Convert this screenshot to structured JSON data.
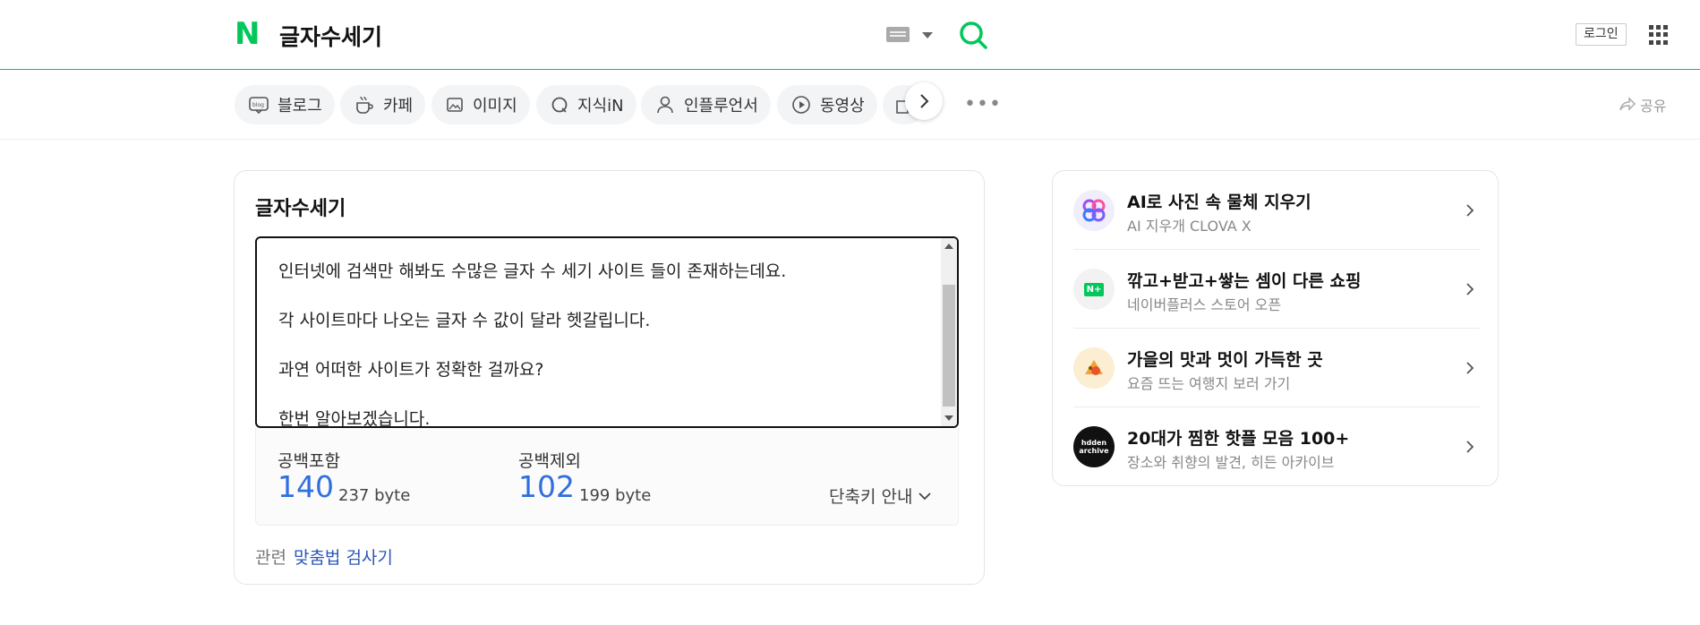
{
  "header": {
    "logo": "N",
    "query": "글자수세기",
    "login_label": "로그인"
  },
  "tabs": [
    {
      "label": "블로그",
      "icon": "blog-icon"
    },
    {
      "label": "카페",
      "icon": "cafe-icon"
    },
    {
      "label": "이미지",
      "icon": "image-icon"
    },
    {
      "label": "지식iN",
      "icon": "kin-icon"
    },
    {
      "label": "인플루언서",
      "icon": "person-icon"
    },
    {
      "label": "동영상",
      "icon": "play-icon"
    }
  ],
  "share_label": "공유",
  "counter": {
    "title": "글자수세기",
    "text_lines": [
      "인터넷에 검색만 해봐도 수많은 글자 수 세기 사이트 들이 존재하는데요.",
      "각 사이트마다 나오는 글자 수 값이 달라 헷갈립니다.",
      "과연 어떠한 사이트가 정확한 걸까요?",
      "한번 알아보겠습니다."
    ],
    "with_spaces_label": "공백포함",
    "with_spaces_count": "140",
    "with_spaces_bytes": "237 byte",
    "without_spaces_label": "공백제외",
    "without_spaces_count": "102",
    "without_spaces_bytes": "199 byte",
    "shortcut_label": "단축키 안내",
    "related_label": "관련",
    "related_link": "맞춤법 검사기"
  },
  "side_ads": [
    {
      "title": "AI로 사진 속 물체 지우기",
      "subtitle": "AI 지우개 CLOVA X"
    },
    {
      "title": "깎고+받고+쌓는 셈이 다른 쇼핑",
      "subtitle": "네이버플러스 스토어 오픈",
      "badge": "N+"
    },
    {
      "title": "가을의 맛과 멋이 가득한 곳",
      "subtitle": "요즘 뜨는 여행지 보러 가기"
    },
    {
      "title": "20대가 찜한 핫플 모음 100+",
      "subtitle": "장소와 취향의 발견, 히든 아카이브",
      "badge": "hdden archive"
    }
  ],
  "colors": {
    "brand": "#03c75a",
    "count": "#2f6fde",
    "link": "#2d57b6"
  }
}
